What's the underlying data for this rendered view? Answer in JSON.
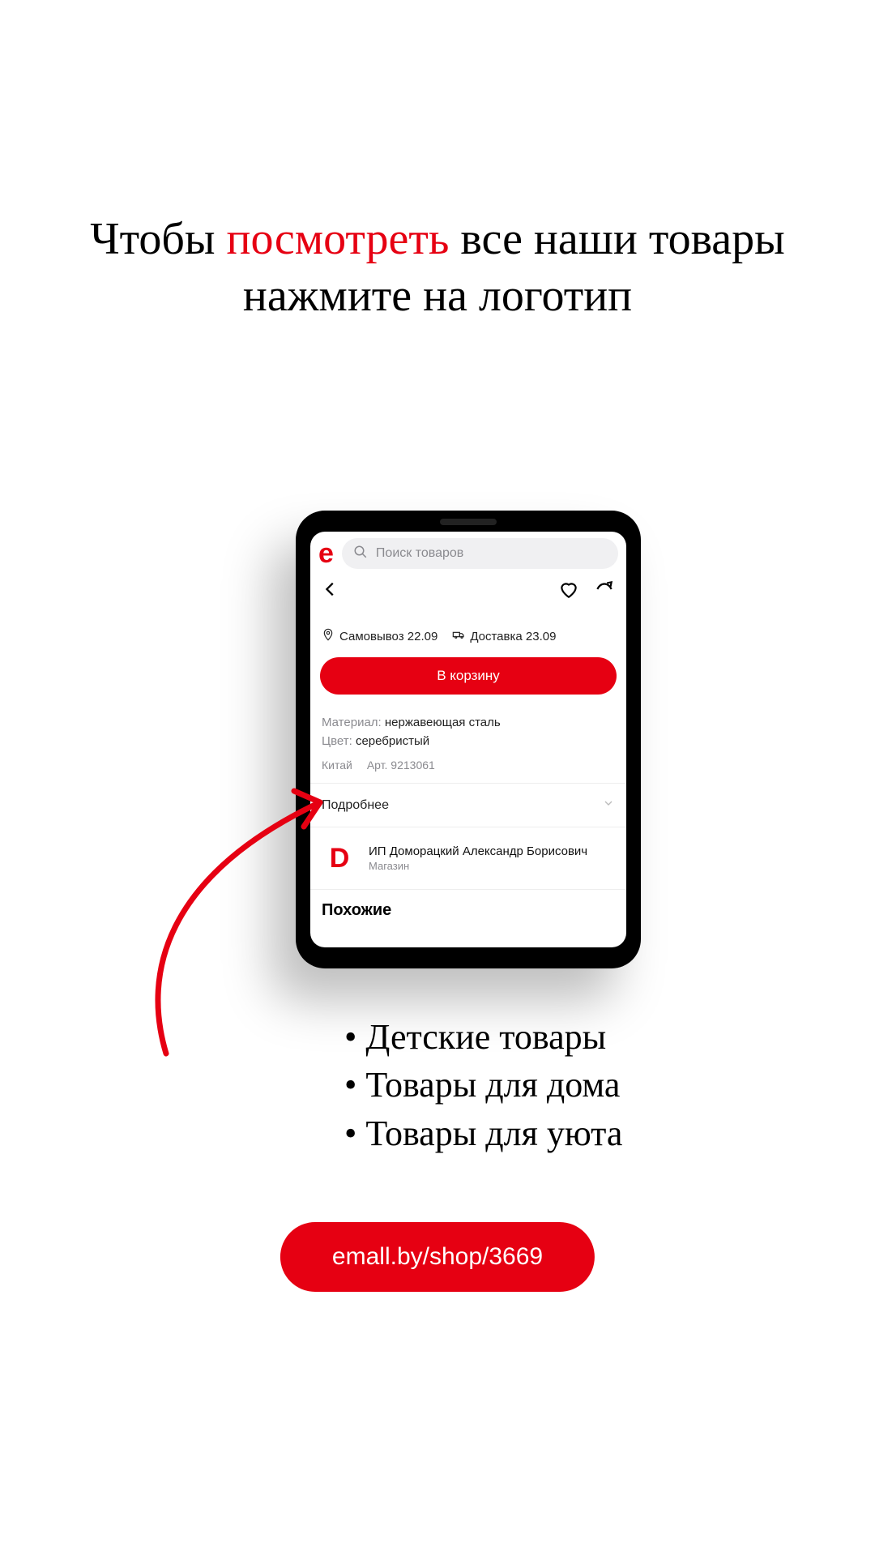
{
  "headline": {
    "part1": "Чтобы ",
    "accent": "посмотреть",
    "part2": " все наши товары",
    "line2": "нажмите на логотип"
  },
  "app": {
    "logo_letter": "e",
    "search_placeholder": "Поиск товаров",
    "pickup_label": "Самовывоз 22.09",
    "delivery_label": "Доставка 23.09",
    "cta_label": "В корзину",
    "specs": {
      "material_label": "Материал:",
      "material_value": "нержавеющая сталь",
      "color_label": "Цвет:",
      "color_value": "серебристый"
    },
    "country": "Китай",
    "sku_label": "Арт. 9213061",
    "more_label": "Подробнее",
    "shop": {
      "avatar_letter": "D",
      "name": "ИП Доморацкий Александр Борисович",
      "sub": "Магазин"
    },
    "similar_label": "Похожие"
  },
  "bullets": [
    "Детские товары",
    "Товары для дома",
    "Товары для уюта"
  ],
  "link_label": "emall.by/shop/3669",
  "colors": {
    "accent": "#e60012"
  }
}
